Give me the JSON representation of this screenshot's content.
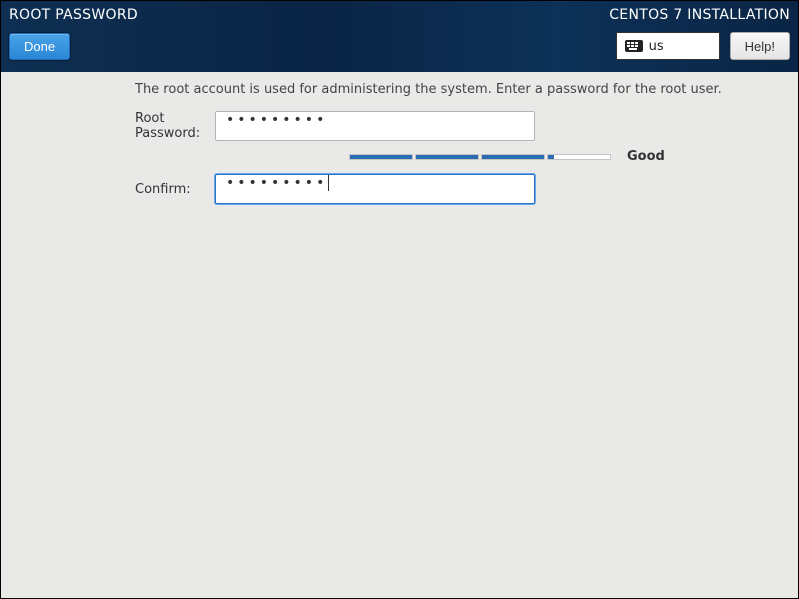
{
  "header": {
    "page_title": "ROOT PASSWORD",
    "installer_title": "CENTOS 7 INSTALLATION",
    "done_label": "Done",
    "help_label": "Help!",
    "keyboard_layout": "us"
  },
  "main": {
    "intro_text": "The root account is used for administering the system.  Enter a password for the root user.",
    "root_password_label": "Root Password:",
    "confirm_label": "Confirm:",
    "root_password_mask": "•••••••••",
    "confirm_password_mask": "•••••••••",
    "strength": {
      "label": "Good",
      "segments_filled": 3,
      "segments_total": 4,
      "last_segment_partial_pct": 10
    }
  },
  "colors": {
    "accent_blue": "#2a74c7",
    "header_bg": "#0b2a4a",
    "meter_fill": "#2a6db2"
  }
}
